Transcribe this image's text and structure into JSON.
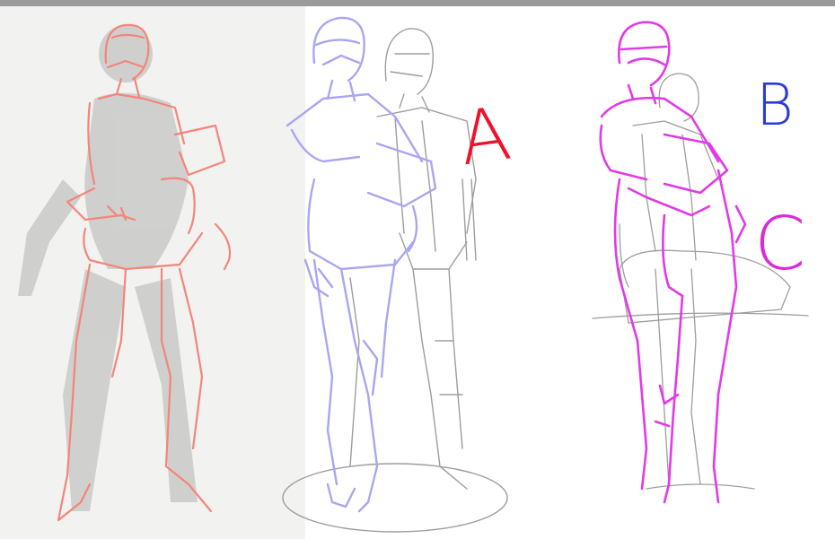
{
  "image": {
    "labels": {
      "a": "A",
      "b": "B",
      "c": "C"
    },
    "colors": {
      "sketch_a": "#f4857a",
      "sketch_b": "#a9a6f2",
      "sketch_c": "#e13ae7",
      "gray_lines": "#9d9d9d",
      "topbar": "#9a9a9a",
      "label_a": "#f0102a",
      "label_b": "#2a3bd8",
      "label_c": "#d82cd8"
    }
  }
}
